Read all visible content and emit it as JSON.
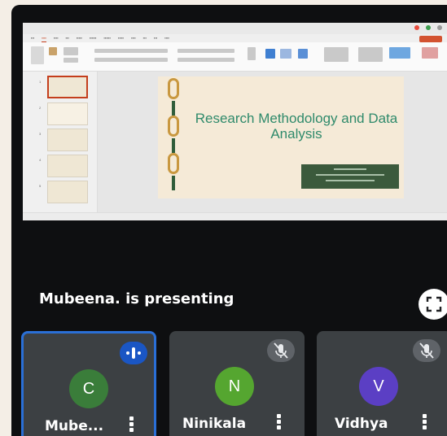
{
  "shared_screen": {
    "slide_title": "Research Methodology and Data Analysis"
  },
  "presenting_label": "Mubeena. is presenting",
  "participants": [
    {
      "initial": "C",
      "name": "Mube...",
      "avatar_color": "#3a7d3a",
      "mic": "speaking"
    },
    {
      "initial": "N",
      "name": "Ninikala",
      "avatar_color": "#55a630",
      "mic": "muted"
    },
    {
      "initial": "V",
      "name": "Vidhya",
      "avatar_color": "#5b3fc4",
      "mic": "muted"
    }
  ],
  "icons": {
    "fullscreen": "fullscreen-icon",
    "speaking": "audio-wave-icon",
    "muted": "mic-off-icon",
    "more": "more-vert-icon"
  },
  "colors": {
    "background": "#0e0f11",
    "tile": "#3c4043",
    "active_border": "#2a6fd6",
    "slide_title": "#2f8a6b"
  }
}
